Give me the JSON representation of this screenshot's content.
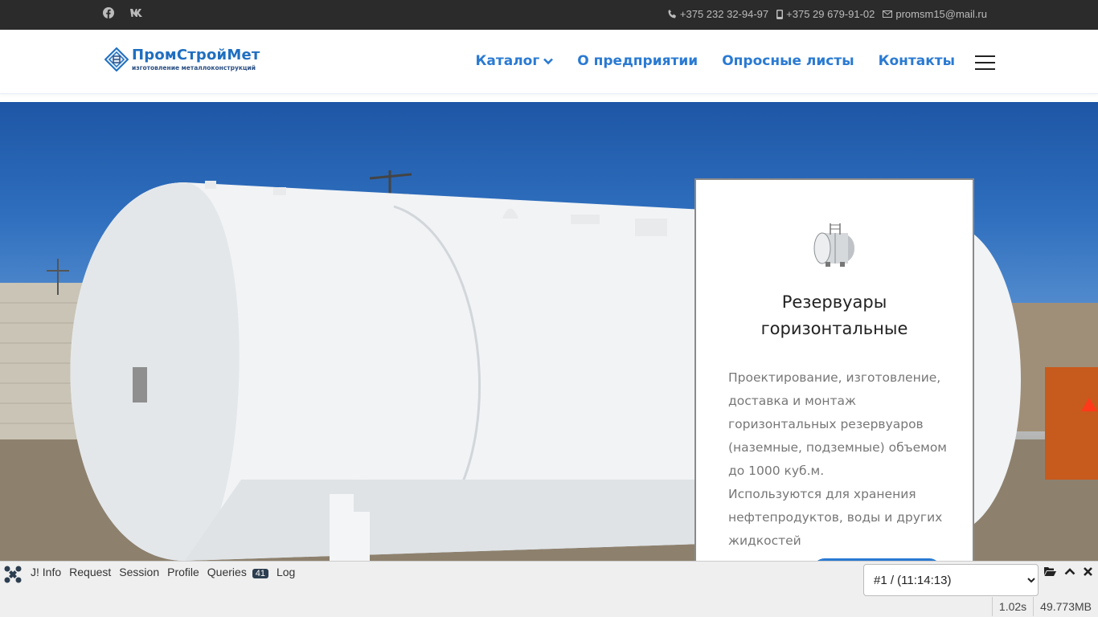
{
  "topbar": {
    "social": [
      {
        "icon": "facebook-icon"
      },
      {
        "icon": "vk-icon"
      }
    ],
    "phone1": "+375 232 32-94-97",
    "phone2": "+375 29 679-91-02",
    "email": "promsm15@mail.ru"
  },
  "header": {
    "logo_name": "ПромСтройМет",
    "logo_tagline": "изготовление металлоконструкций",
    "nav": [
      {
        "label": "Каталог"
      },
      {
        "label": "О предприятии"
      },
      {
        "label": "Опросные листы"
      },
      {
        "label": "Контакты"
      }
    ]
  },
  "card": {
    "title_line1": "Резервуары",
    "title_line2": "горизонтальные",
    "desc_line1": "Проектирование, изготовление, доставка и монтаж горизонтальных резервуаров (наземные, подземные) объемом до 1000 куб.м.",
    "desc_line2": "Используются для хранения нефтепродуктов, воды и других жидкостей"
  },
  "debug": {
    "tabs": [
      "J! Info",
      "Request",
      "Session",
      "Profile",
      "Queries",
      "Log"
    ],
    "queries_count": "41",
    "request_option": "#1 / (11:14:13)",
    "time": "1.02s",
    "memory": "49.773MB"
  },
  "colors": {
    "accent": "#2a7ad2",
    "topbar_bg": "#2b2b2b",
    "debug_bg": "#efefef"
  }
}
